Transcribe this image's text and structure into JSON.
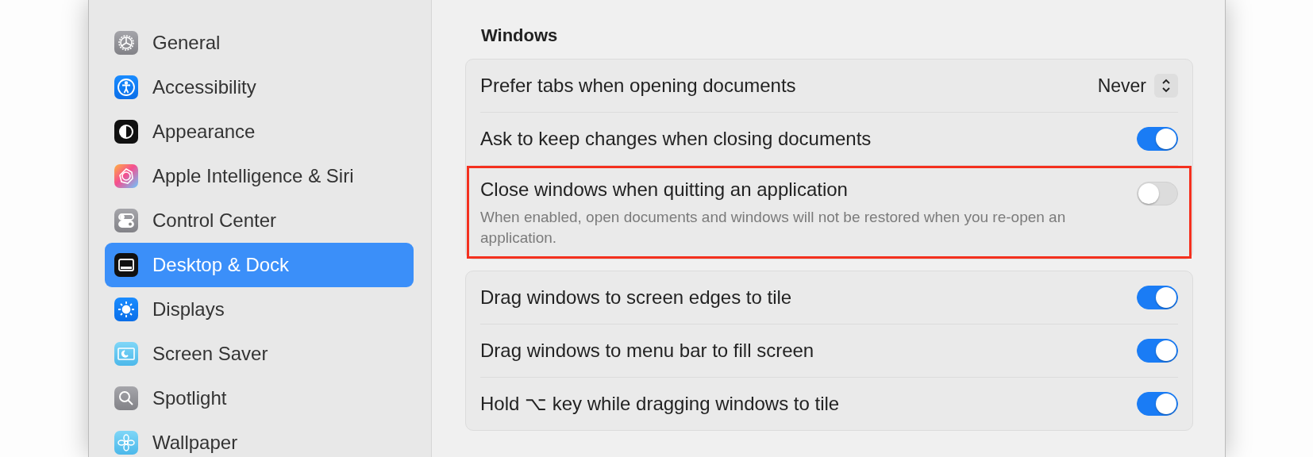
{
  "sidebar": {
    "items": [
      {
        "label": "General",
        "selected": false
      },
      {
        "label": "Accessibility",
        "selected": false
      },
      {
        "label": "Appearance",
        "selected": false
      },
      {
        "label": "Apple Intelligence & Siri",
        "selected": false
      },
      {
        "label": "Control Center",
        "selected": false
      },
      {
        "label": "Desktop & Dock",
        "selected": true
      },
      {
        "label": "Displays",
        "selected": false
      },
      {
        "label": "Screen Saver",
        "selected": false
      },
      {
        "label": "Spotlight",
        "selected": false
      },
      {
        "label": "Wallpaper",
        "selected": false
      }
    ]
  },
  "section": {
    "title": "Windows",
    "groups": [
      {
        "rows": [
          {
            "kind": "popup",
            "label": "Prefer tabs when opening documents",
            "value": "Never",
            "highlighted": false
          },
          {
            "kind": "toggle",
            "label": "Ask to keep changes when closing documents",
            "on": true,
            "highlighted": false
          },
          {
            "kind": "toggle",
            "label": "Close windows when quitting an application",
            "description": "When enabled, open documents and windows will not be restored when you re-open an application.",
            "on": false,
            "highlighted": true
          }
        ]
      },
      {
        "rows": [
          {
            "kind": "toggle",
            "label": "Drag windows to screen edges to tile",
            "on": true,
            "highlighted": false
          },
          {
            "kind": "toggle",
            "label": "Drag windows to menu bar to fill screen",
            "on": true,
            "highlighted": false
          },
          {
            "kind": "toggle",
            "label": "Hold ⌥ key while dragging windows to tile",
            "on": true,
            "highlighted": false
          }
        ]
      }
    ]
  }
}
